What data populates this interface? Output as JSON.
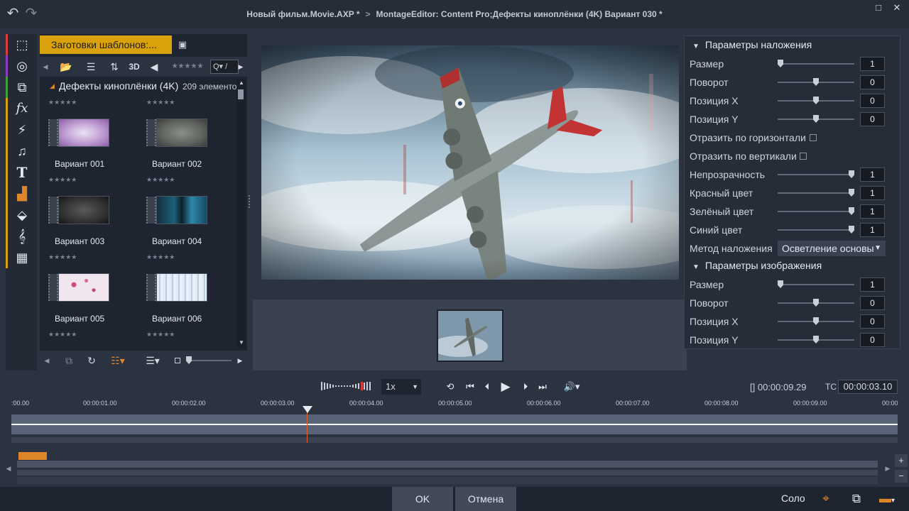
{
  "window": {
    "title_project": "Новый фильм.Movie.AXP *",
    "title_editor": "MontageEditor: Content Pro;Дефекты киноплёнки (4K)  Вариант 030 *"
  },
  "library": {
    "header": "Заготовки шаблонов:...",
    "toolbar_3d": "3D",
    "toolbar_stars": "★★★★★",
    "search_text": "Q▾ /",
    "folder_title": "Дефекты киноплёнки (4K)",
    "item_count": "209 элементо",
    "tiles": [
      {
        "label": "Вариант 001",
        "rating": "★★★★★"
      },
      {
        "label": "Вариант 002",
        "rating": "★★★★★"
      },
      {
        "label": "Вариант 003",
        "rating": "★★★★★"
      },
      {
        "label": "Вариант 004",
        "rating": "★★★★★"
      },
      {
        "label": "Вариант 005",
        "rating": "★★★★★"
      },
      {
        "label": "Вариант 006",
        "rating": "★★★★★"
      }
    ],
    "top_ratings": [
      "★★★★★",
      "★★★★★"
    ]
  },
  "params": {
    "overlay_section": "Параметры наложения",
    "image_section": "Параметры изображения",
    "overlay": [
      {
        "label": "Размер",
        "value": "1",
        "slider": 0.0
      },
      {
        "label": "Поворот",
        "value": "0",
        "slider": 0.5
      },
      {
        "label": "Позиция X",
        "value": "0",
        "slider": 0.5
      },
      {
        "label": "Позиция Y",
        "value": "0",
        "slider": 0.5
      }
    ],
    "flip_h": "Отразить по горизонтали",
    "flip_v": "Отразить по вертикали",
    "color": [
      {
        "label": "Непрозрачность",
        "value": "1",
        "slider": 1.0
      },
      {
        "label": "Красный цвет",
        "value": "1",
        "slider": 1.0
      },
      {
        "label": "Зелёный цвет",
        "value": "1",
        "slider": 1.0
      },
      {
        "label": "Синий цвет",
        "value": "1",
        "slider": 1.0
      }
    ],
    "blend_label": "Метод наложения",
    "blend_value": "Осветление основы",
    "image": [
      {
        "label": "Размер",
        "value": "1",
        "slider": 0.0
      },
      {
        "label": "Поворот",
        "value": "0",
        "slider": 0.5
      },
      {
        "label": "Позиция X",
        "value": "0",
        "slider": 0.5
      },
      {
        "label": "Позиция Y",
        "value": "0",
        "slider": 0.5
      }
    ]
  },
  "transport": {
    "speed": "1x",
    "duration": "[] 00:00:09.29",
    "tc_label": "TC",
    "timecode": "00:00:03.10",
    "ruler": [
      ":00.00",
      "00:00:01.00",
      "00:00:02.00",
      "00:00:03.00",
      "00:00:04.00",
      "00:00:05.00",
      "00:00:06.00",
      "00:00:07.00",
      "00:00:08.00",
      "00:00:09.00",
      "00:00"
    ]
  },
  "buttons": {
    "ok": "OK",
    "cancel": "Отмена",
    "solo": "Соло"
  },
  "colors": {
    "accent_orange": "#e0862a",
    "tab_yellow": "#d9a10c",
    "panel": "#2b3240"
  },
  "icons": {
    "iconbar": [
      "package-icon",
      "disc-icon",
      "media-stack-icon",
      "fx-icon",
      "lightning-icon",
      "music-note-icon",
      "title-text-icon",
      "pattern-icon",
      "layers-icon",
      "stock-icon",
      "filmstrip-icon"
    ]
  }
}
